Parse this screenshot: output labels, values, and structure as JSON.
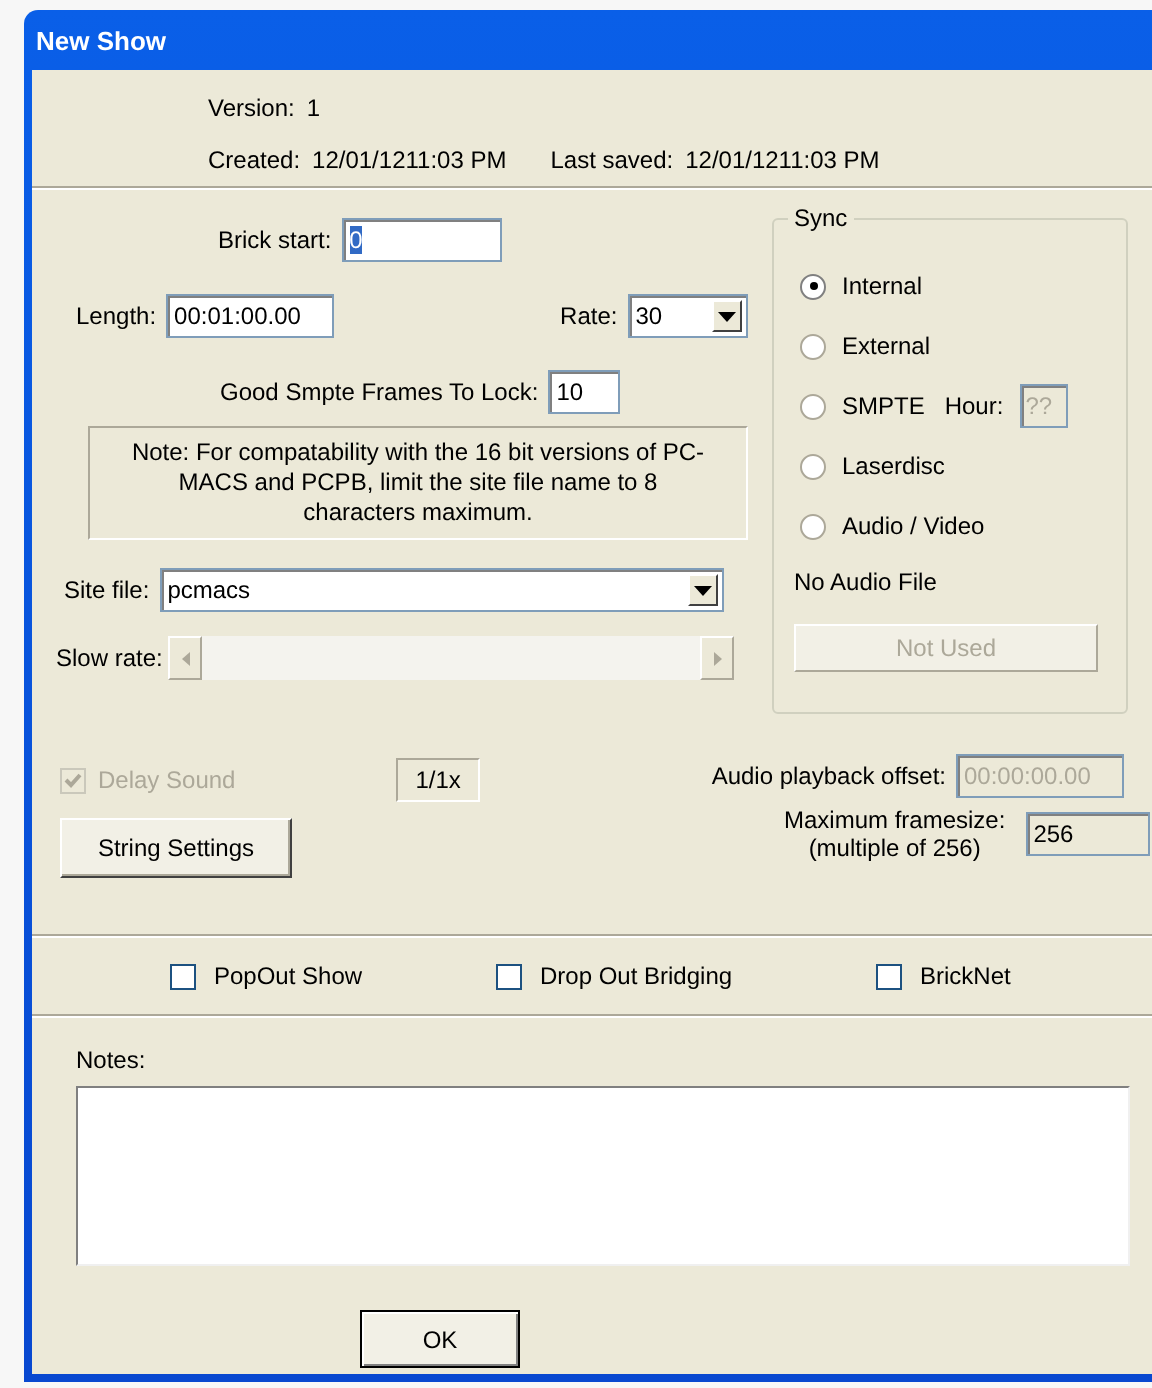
{
  "window": {
    "title": "New Show"
  },
  "version": {
    "label": "Version:",
    "value": "1"
  },
  "created": {
    "label": "Created:",
    "value": "12/01/1211:03 PM"
  },
  "last_saved": {
    "label": "Last saved:",
    "value": "12/01/1211:03 PM"
  },
  "brick_start": {
    "label": "Brick start:",
    "value": "0"
  },
  "length": {
    "label": "Length:",
    "value": "00:01:00.00"
  },
  "rate": {
    "label": "Rate:",
    "value": "30"
  },
  "lock_frames": {
    "label": "Good Smpte Frames To Lock:",
    "value": "10"
  },
  "note": "Note: For compatability with the 16 bit versions of PC-MACS and PCPB, limit the site file name to 8 characters maximum.",
  "site_file": {
    "label": "Site file:",
    "value": "pcmacs"
  },
  "slow_rate": {
    "label": "Slow rate:",
    "disabled": true
  },
  "delay_sound": {
    "label": "Delay Sound",
    "checked": true,
    "disabled": true
  },
  "speed": "1/1x",
  "string_settings": "String Settings",
  "audio_offset": {
    "label": "Audio playback offset:",
    "value": "00:00:00.00",
    "disabled": true
  },
  "max_framesize": {
    "label": "Maximum framesize:",
    "sublabel": "(multiple of 256)",
    "value": "256"
  },
  "sync": {
    "title": "Sync",
    "options": [
      {
        "label": "Internal",
        "selected": true
      },
      {
        "label": "External",
        "selected": false
      },
      {
        "label": "SMPTE",
        "selected": false,
        "hour": {
          "label": "Hour:",
          "value": "??"
        }
      },
      {
        "label": "Laserdisc",
        "selected": false
      },
      {
        "label": "Audio / Video",
        "selected": false
      }
    ],
    "audio_file": "No Audio File",
    "button": {
      "label": "Not Used",
      "disabled": true
    }
  },
  "options": [
    {
      "label": "PopOut Show",
      "checked": false
    },
    {
      "label": "Drop Out Bridging",
      "checked": false
    },
    {
      "label": "BrickNet",
      "checked": false
    }
  ],
  "notes": {
    "label": "Notes:"
  },
  "ok": "OK"
}
